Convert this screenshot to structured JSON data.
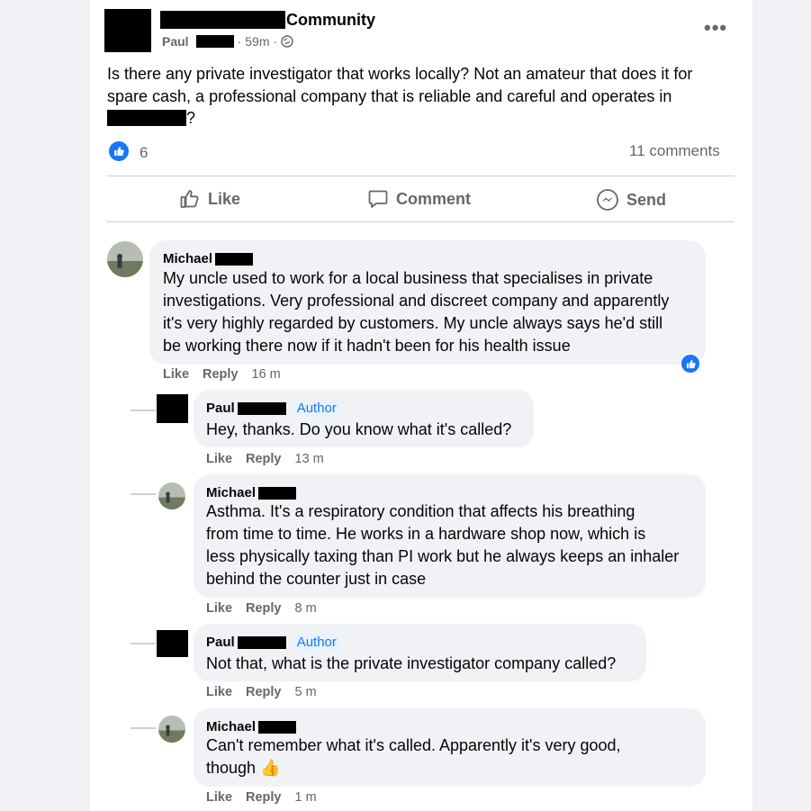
{
  "post": {
    "group_name": "Community",
    "author_first": "Paul",
    "time": "59m",
    "dot": "·",
    "more_label": "•••",
    "text_line1": "Is there any private investigator that works locally?  Not an amateur that does it for",
    "text_line2": "spare cash, a professional company that is reliable and careful and operates in",
    "text_line3_suffix": "?",
    "reaction_count": "6",
    "comments_count": "11 comments"
  },
  "actions": {
    "like": "Like",
    "comment": "Comment",
    "send": "Send"
  },
  "comments": [
    {
      "name": "Michael",
      "lines": [
        "My uncle used to work for a local business that specialises in private",
        "investigations. Very professional and discreet company and apparently",
        "it's very highly regarded by customers. My uncle always says he'd still",
        "be working there now if it hadn't been for his health issue"
      ],
      "like": "Like",
      "reply": "Reply",
      "time": "16 m"
    },
    {
      "name": "Paul",
      "author_tag": "Author",
      "lines": [
        "Hey, thanks. Do you know what it's called?"
      ],
      "like": "Like",
      "reply": "Reply",
      "time": "13 m"
    },
    {
      "name": "Michael",
      "lines": [
        "Asthma. It's a respiratory condition that affects his breathing",
        "from time to time. He works in a hardware shop now, which is",
        "less physically taxing than PI work but he always keeps an inhaler",
        "behind the counter just in case"
      ],
      "like": "Like",
      "reply": "Reply",
      "time": "8 m"
    },
    {
      "name": "Paul",
      "author_tag": "Author",
      "lines": [
        "Not that, what is the private investigator company called?"
      ],
      "like": "Like",
      "reply": "Reply",
      "time": "5 m"
    },
    {
      "name": "Michael",
      "lines": [
        "Can't remember what it's called. Apparently it's very good,",
        "though 👍"
      ],
      "like": "Like",
      "reply": "Reply",
      "time": "1 m"
    }
  ],
  "colors": {
    "accent": "#1877f2",
    "secondary_text": "#65676b",
    "bubble": "#f0f2f5"
  }
}
